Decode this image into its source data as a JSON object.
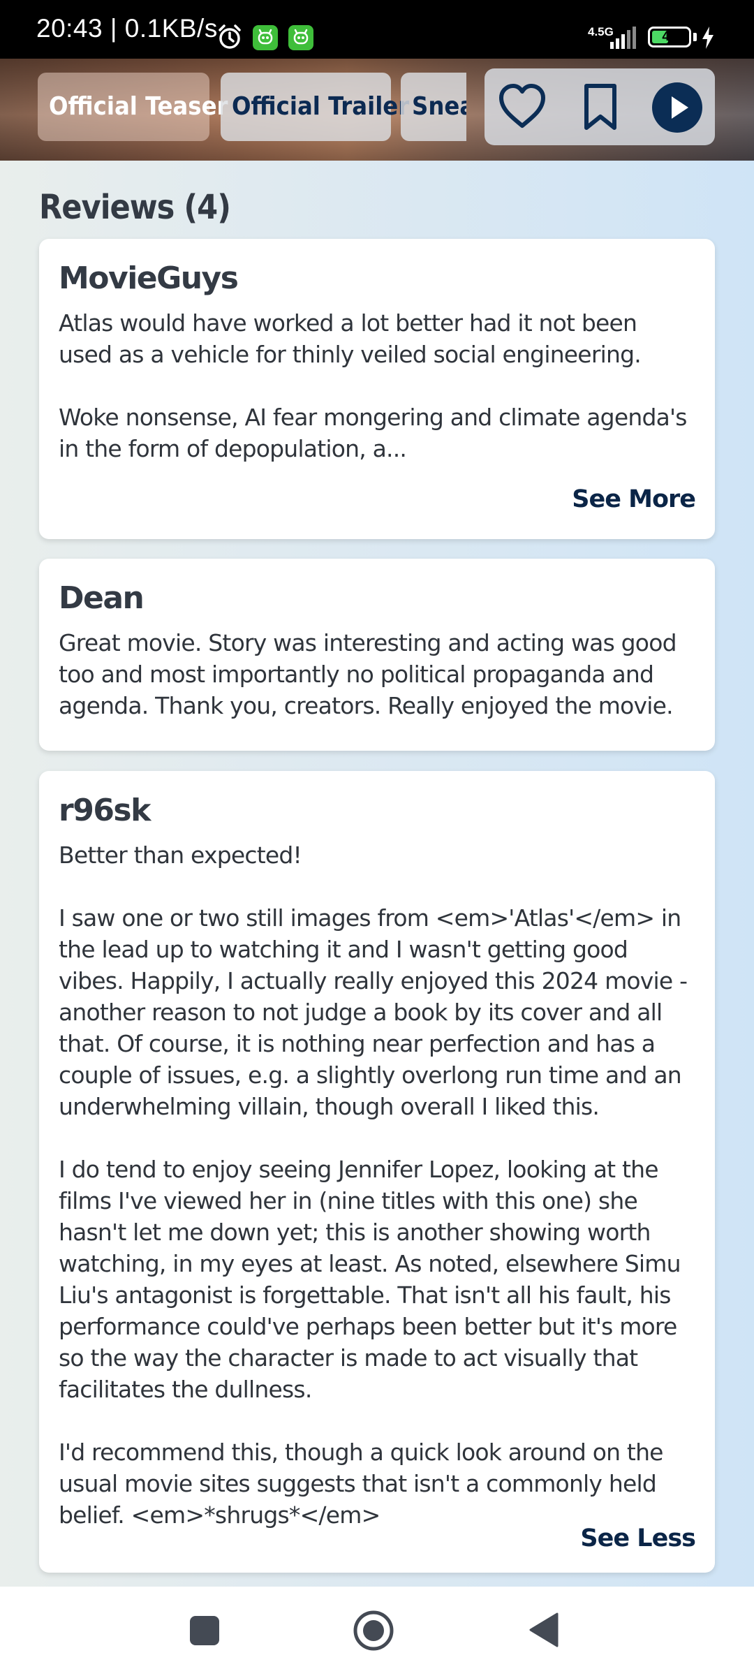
{
  "status_bar": {
    "time": "20:43 | 0.1KB/s",
    "network": "4.5G",
    "battery": "45",
    "battery_level": 0.45,
    "icons": [
      "alarm-icon",
      "app-notification-icon",
      "app-notification-icon",
      "signal-icon",
      "battery-icon",
      "charging-icon"
    ]
  },
  "header": {
    "video_tabs": [
      {
        "label": "Official Teaser",
        "active": true
      },
      {
        "label": "Official Trailer",
        "active": false
      },
      {
        "label": "Sneak",
        "active": false
      }
    ],
    "actions": {
      "favorite_icon": "heart-icon",
      "watchlist_icon": "bookmark-icon",
      "play_icon": "play-icon"
    }
  },
  "reviews": {
    "heading": "Reviews (4)",
    "items": [
      {
        "author": "MovieGuys",
        "text": "Atlas would have worked a lot better had it not been used as a vehicle for thinly veiled social engineering.\n\nWoke nonsense, AI fear mongering and climate agenda's in the form of depopulation, a...",
        "toggle": "See More"
      },
      {
        "author": "Dean",
        "text": "Great movie. Story was interesting and acting was good too and most importantly no political propaganda and agenda. Thank you, creators. Really enjoyed the movie.",
        "toggle": ""
      },
      {
        "author": "r96sk",
        "text": "Better than expected!\n\nI saw one or two still images from <em>'Atlas'</em> in the lead up to watching it and I wasn't getting good vibes. Happily, I actually really enjoyed this 2024 movie - another reason to not judge a book by its cover and all that. Of course, it is nothing near perfection and has a couple of issues, e.g. a slightly overlong run time and an underwhelming villain, though overall I liked this.\n\nI do tend to enjoy seeing Jennifer Lopez, looking at the films I've viewed her in (nine titles with this one) she hasn't let me down yet; this is another showing worth watching, in my eyes at least. As noted, elsewhere Simu Liu's antagonist is forgettable. That isn't all his fault, his performance could've perhaps been better but it's more so the way the character is made to act visually that facilitates the dullness.\n\nI'd recommend this, though a quick look around on the usual movie sites suggests that isn't a commonly held belief. <em>*shrugs*</em>",
        "toggle": "See Less"
      }
    ]
  },
  "nav_bar": {
    "icons": [
      "recents-icon",
      "home-icon",
      "back-icon"
    ]
  },
  "colors": {
    "accent": "#0b2d55",
    "card": "#ffffff",
    "text": "#2f343b"
  }
}
